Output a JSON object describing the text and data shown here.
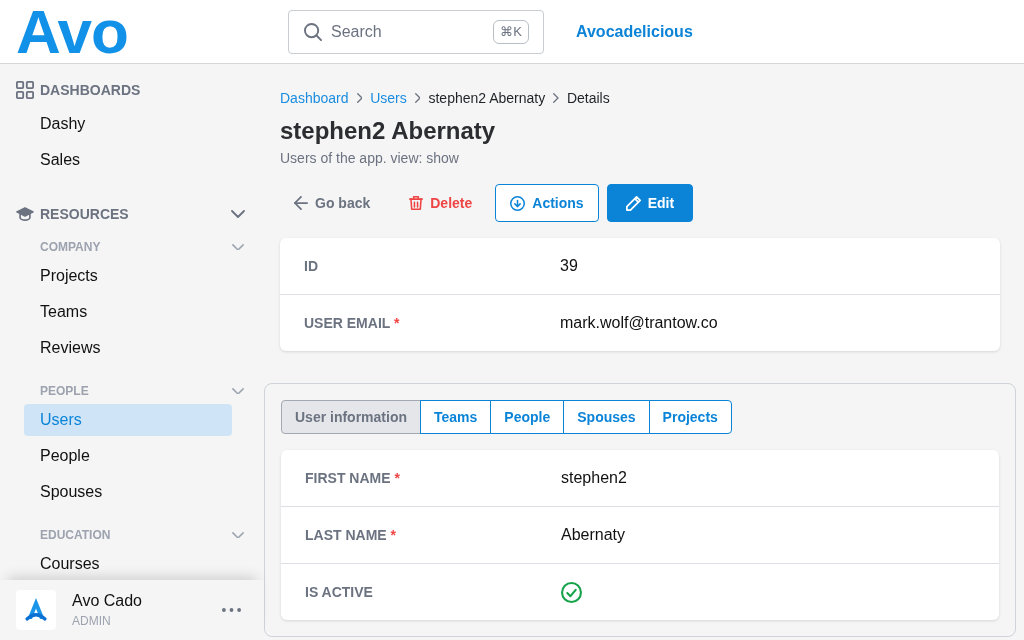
{
  "header": {
    "logo": "Avo",
    "search": {
      "placeholder": "Search",
      "shortcut": "⌘K"
    },
    "app_link": "Avocadelicious"
  },
  "sidebar": {
    "sections": [
      {
        "title": "DASHBOARDS",
        "items": [
          {
            "label": "Dashy",
            "selected": false
          },
          {
            "label": "Sales",
            "selected": false
          }
        ]
      },
      {
        "title": "RESOURCES",
        "expanded": true,
        "groups": [
          {
            "title": "COMPANY",
            "expanded": true,
            "items": [
              {
                "label": "Projects",
                "selected": false
              },
              {
                "label": "Teams",
                "selected": false
              },
              {
                "label": "Reviews",
                "selected": false
              }
            ]
          },
          {
            "title": "PEOPLE",
            "expanded": true,
            "items": [
              {
                "label": "Users",
                "selected": true
              },
              {
                "label": "People",
                "selected": false
              },
              {
                "label": "Spouses",
                "selected": false
              }
            ]
          },
          {
            "title": "EDUCATION",
            "expanded": true,
            "items": [
              {
                "label": "Courses",
                "selected": false
              }
            ]
          }
        ]
      }
    ],
    "user": {
      "name": "Avo Cado",
      "role": "ADMIN"
    }
  },
  "breadcrumb": [
    {
      "label": "Dashboard",
      "link": true
    },
    {
      "label": "Users",
      "link": true
    },
    {
      "label": "stephen2 Abernaty",
      "link": false
    },
    {
      "label": "Details",
      "link": false
    }
  ],
  "page": {
    "title": "stephen2 Abernaty",
    "subtitle": "Users of the app. view: show"
  },
  "actions": [
    {
      "kind": "back",
      "label": "Go back"
    },
    {
      "kind": "delete",
      "label": "Delete"
    },
    {
      "kind": "actions",
      "label": "Actions"
    },
    {
      "kind": "edit",
      "label": "Edit"
    }
  ],
  "details": {
    "fields": [
      {
        "kind": "text",
        "label": "ID",
        "value": "39"
      },
      {
        "kind": "text",
        "label": "USER EMAIL",
        "required_mark": "*",
        "value": "mark.wolf@trantow.co"
      }
    ]
  },
  "panel": {
    "tabs": [
      {
        "label": "User information",
        "selected": true
      },
      {
        "label": "Teams",
        "selected": false
      },
      {
        "label": "People",
        "selected": false
      },
      {
        "label": "Spouses",
        "selected": false
      },
      {
        "label": "Projects",
        "selected": false
      }
    ],
    "fields": [
      {
        "kind": "text",
        "label": "FIRST NAME",
        "required_mark": "*",
        "value": "stephen2"
      },
      {
        "kind": "text",
        "label": "LAST NAME",
        "required_mark": "*",
        "value": "Abernaty"
      },
      {
        "kind": "boolean",
        "label": "IS ACTIVE",
        "value": true
      }
    ]
  }
}
